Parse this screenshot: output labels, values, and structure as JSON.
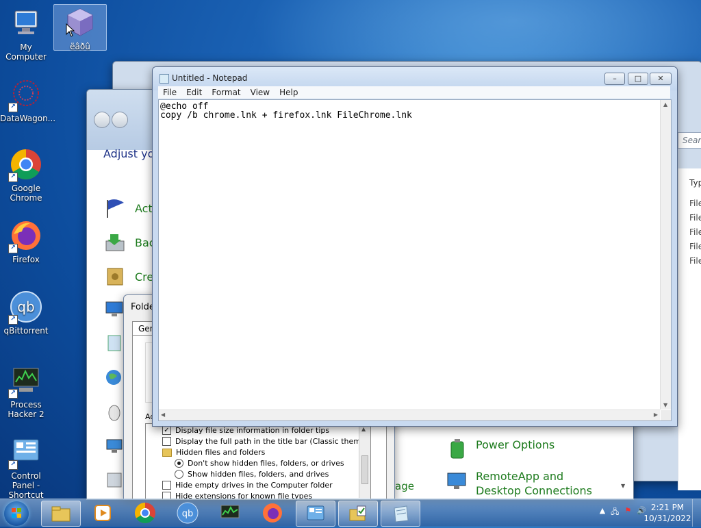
{
  "desktop": {
    "icons": [
      {
        "label": "My Computer"
      },
      {
        "label": "ëâðû"
      },
      {
        "label": "DataWagon..."
      },
      {
        "label": "Google Chrome"
      },
      {
        "label": "Firefox"
      },
      {
        "label": "qBittorrent"
      },
      {
        "label": "Process Hacker 2"
      },
      {
        "label": "Control Panel - Shortcut"
      }
    ]
  },
  "control_panel": {
    "heading": "Adjust you",
    "items": [
      "Acti",
      "Back",
      "Cre"
    ],
    "right_items": [
      "Power Options",
      "RemoteApp and Desktop Connections"
    ],
    "partial_text": "age"
  },
  "explorer": {
    "search_placeholder": "Searc",
    "column_header": "Typ",
    "rows": [
      "File",
      "File",
      "File",
      "File",
      "File"
    ]
  },
  "folder_options": {
    "title": "Folde",
    "tab": "Gen",
    "advanced_label": "Ad",
    "items": [
      {
        "type": "checkbox",
        "checked": true,
        "label": "Display file size information in folder tips"
      },
      {
        "type": "checkbox",
        "checked": false,
        "label": "Display the full path in the title bar (Classic theme only)"
      },
      {
        "type": "folder",
        "label": "Hidden files and folders"
      },
      {
        "type": "radio",
        "checked": true,
        "label": "Don't show hidden files, folders, or drives"
      },
      {
        "type": "radio",
        "checked": false,
        "label": "Show hidden files, folders, and drives"
      },
      {
        "type": "checkbox",
        "checked": false,
        "label": "Hide empty drives in the Computer folder"
      },
      {
        "type": "checkbox",
        "checked": false,
        "label": "Hide extensions for known file types"
      }
    ]
  },
  "notepad": {
    "title": "Untitled - Notepad",
    "menu": [
      "File",
      "Edit",
      "Format",
      "View",
      "Help"
    ],
    "content": "@echo off\ncopy /b chrome.lnk + firefox.lnk FileChrome.lnk",
    "controls": {
      "minimize": "–",
      "maximize": "□",
      "close": "✕"
    }
  },
  "taskbar": {
    "apps": [
      "file-explorer",
      "media-player",
      "google-chrome",
      "qbittorrent",
      "process-hacker",
      "firefox",
      "control-panel",
      "folder-options",
      "notepad"
    ],
    "clock_time": "2:21 PM",
    "clock_date": "10/31/2022"
  }
}
